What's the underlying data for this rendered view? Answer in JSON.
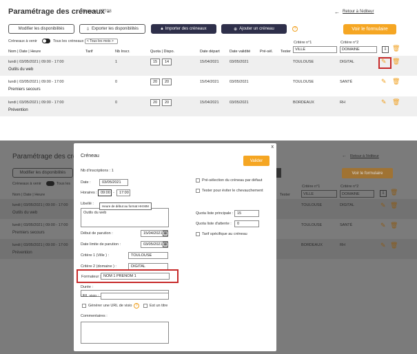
{
  "header": {
    "title": "Paramétrage des créneaux -",
    "fiche": "Fiche n° 67708",
    "back_link": "Retour à l'éditeur",
    "back_arrow": "←"
  },
  "toolbar": {
    "modify_label": "Modifier les disponibilités",
    "export_label": "Exporter les disponibilités",
    "import_label": "Importer des créneaux",
    "add_label": "Ajouter un créneau",
    "help_icon": "?",
    "formulaire_label": "Voir le formulaire"
  },
  "filters": {
    "creneaux_label": "Créneaux à venir",
    "tous_label": "Tous les créneaux",
    "month_select": "< Tous les mois >",
    "critere1_label": "Critère n°1",
    "critere2_label": "Critère n°2",
    "critere1_value": "VILLE",
    "critere2_value": "DOMAINE"
  },
  "table": {
    "columns": [
      "Nom | Date | Heure",
      "Tarif",
      "Nb Inscr.",
      "Quota | Dispo.",
      "Date départ",
      "Date validité",
      "Pré-sél.",
      "Tester"
    ],
    "rows": [
      {
        "date": "lundi | 03/05/2021 | 09:00 - 17:00",
        "name": "Outils du web",
        "inscr": "1",
        "quota": "15",
        "dispo": "14",
        "depart": "15/04/2021",
        "validite": "03/05/2021",
        "c1": "TOULOUSE",
        "c2": "DIGITAL"
      },
      {
        "date": "lundi | 03/05/2021 | 09:00 - 17:00",
        "name": "Premiers secours",
        "inscr": "0",
        "quota": "20",
        "dispo": "20",
        "depart": "15/04/2021",
        "validite": "03/05/2021",
        "c1": "TOULOUSE",
        "c2": "SANTÉ"
      },
      {
        "date": "lundi | 03/05/2021 | 09:00 - 17:00",
        "name": "Prévention",
        "inscr": "0",
        "quota": "20",
        "dispo": "20",
        "depart": "15/04/2021",
        "validite": "03/05/2021",
        "c1": "BORDEAUX",
        "c2": "RH"
      }
    ]
  },
  "bottom_bg": {
    "title": "Paramétrage des créneaux -",
    "modify_label": "Modifier les disponibilités",
    "back_link": "Retour à l'éditeur",
    "formulaire_label": "Voir le formulaire",
    "creneaux_label": "Créneaux à venir",
    "tous_label": "Tous les",
    "col_name": "Nom | Date | Heure",
    "col_tester": "Tester",
    "critere1_label": "Critère n°1",
    "critere2_label": "Critère n°2",
    "critere1_value": "VILLE",
    "critere2_value": "DOMAINE",
    "rows": [
      {
        "date": "lundi | 03/05/2021 | 09:00 - 17:00",
        "name": "Outils du web",
        "c1": "TOULOUSE",
        "c2": "DIGITAL"
      },
      {
        "date": "lundi | 03/05/2021 | 09:00 - 17:00",
        "name": "Premiers secours",
        "c1": "TOULOUSE",
        "c2": "SANTÉ"
      },
      {
        "date": "lundi | 03/05/2021 | 09:00 - 17:00",
        "name": "Prévention",
        "c1": "BORDEAUX",
        "c2": "RH"
      }
    ]
  },
  "modal": {
    "close": "x",
    "title": "Créneau",
    "valider": "Valider",
    "nb_inscriptions": "Nb d'inscriptions : 1",
    "date_label": "Date :",
    "date_value": "03/05/2021",
    "horaires_label": "Horaires :",
    "horaire_start": "09:00",
    "horaire_end": "17:00",
    "libelle_label": "Libellé :",
    "libelle_value": "Outils du web",
    "tooltip": "Heure de début au format HH:MM",
    "debut_label": "Début de parution :",
    "debut_value": "15/04/2021",
    "limite_label": "Date limite de parution :",
    "limite_value": "03/05/2021",
    "critere1_label": "Critère 1 (Ville ) :",
    "critere1_value": "TOULOUSE",
    "critere2_label": "Critère 2 (domaine ) :",
    "critere2_value": "DIGITAL",
    "formateur_label": "Formateur :",
    "formateur_value": "NOM 1 PRENOM 1",
    "duree_label": "Durée :",
    "url_label": "URL visio :",
    "generer_label": "Générer une URL de visio",
    "titre_label": "Est un titre",
    "commentaire_label": "Commentaires :",
    "preselection_label": "Pré-sélection du créneau par défaut",
    "tester_label": "Tester pour éviter le chevauchement",
    "quota_principale_label": "Quota liste principale :",
    "quota_principale_value": "15",
    "quota_attente_label": "Quota liste d'attente :",
    "quota_attente_value": "0",
    "tarif_label": "Tarif spécifique au créneau",
    "help_icon": "?"
  }
}
